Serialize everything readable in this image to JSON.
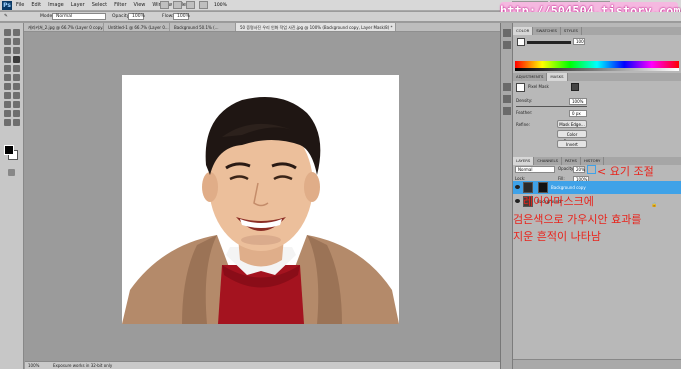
{
  "menubar": {
    "logo": "Ps",
    "items": [
      "File",
      "Edit",
      "Image",
      "Layer",
      "Select",
      "Filter",
      "View",
      "Window",
      "Help"
    ],
    "zoom": "100%"
  },
  "workspaces": [
    "ESSENTIALS",
    "DESIGN",
    "PAINTING"
  ],
  "watermark": "http://504504.tistory.com",
  "options": {
    "mode_label": "Mode:",
    "mode_value": "Normal",
    "opacity_label": "Opacity:",
    "opacity_value": "100%",
    "flow_label": "Flow:",
    "flow_value": "100%"
  },
  "tabs": [
    "캐리커쳐_2.jpg @ 66.7% (Layer 0 copy...",
    "Untitled-1 @ 66.7% (Layer 0...",
    "Background 50.1% (...",
    "50 증명사진 우리 인화 작업 사진.jpg @ 100% (Background copy, Layer Mask/8) *"
  ],
  "status": {
    "zoom": "100%",
    "info": "Exposure works in 32-bit only"
  },
  "panels": {
    "color_tabs": [
      "COLOR",
      "SWATCHES",
      "STYLES"
    ],
    "color_value": "100",
    "adjust_tabs": [
      "ADJUSTMENTS",
      "MASKS"
    ],
    "mask_title": "Pixel Mask",
    "density_label": "Density:",
    "density_value": "100%",
    "feather_label": "Feather:",
    "feather_value": "0 px",
    "refine_label": "Refine:",
    "mask_edge": "Mask Edge...",
    "color_range": "Color Range...",
    "invert": "Invert",
    "layers_tabs": [
      "LAYERS",
      "CHANNELS",
      "PATHS",
      "HISTORY"
    ],
    "blend_mode": "Normal",
    "opacity_label": "Opacity:",
    "opacity_value": "20%",
    "fill_label": "Fill:",
    "fill_value": "100%",
    "lock_label": "Lock:",
    "layers": [
      {
        "name": "Background copy",
        "selected": true
      },
      {
        "name": "Background",
        "selected": false
      }
    ]
  },
  "annotations": {
    "opacity_note": "< 요기 조절",
    "mask_note": "레이어마스크에",
    "line2": "검은색으로 가우시안 효과를",
    "line3": "지운 흔적이 나타남"
  },
  "colors": {
    "selected_layer": "#3fa2e8",
    "annotation": "#e8241c",
    "watermark_bg": "#f5b8e0"
  }
}
